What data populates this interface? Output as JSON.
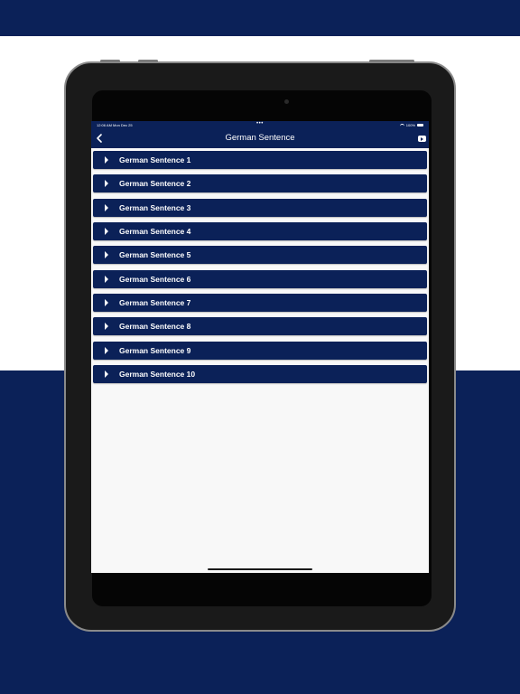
{
  "status_bar": {
    "time": "12:06 AM   Mon Dec 25",
    "dots": "•••",
    "battery": "100%"
  },
  "nav": {
    "title": "German Sentence",
    "back_icon": "chevron-left-icon",
    "right_icon": "youtube-icon"
  },
  "items": [
    {
      "label": "German Sentence 1"
    },
    {
      "label": "German Sentence 2"
    },
    {
      "label": "German Sentence 3"
    },
    {
      "label": "German Sentence 4"
    },
    {
      "label": "German Sentence 5"
    },
    {
      "label": "German Sentence 6"
    },
    {
      "label": "German Sentence 7"
    },
    {
      "label": "German Sentence 8"
    },
    {
      "label": "German Sentence 9"
    },
    {
      "label": "German Sentence 10"
    }
  ],
  "colors": {
    "brand": "#0b2158",
    "screen_bg": "#f8f8f8",
    "text": "#ffffff"
  }
}
